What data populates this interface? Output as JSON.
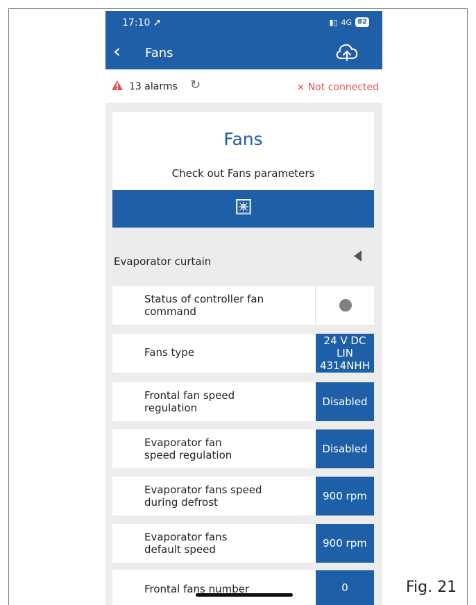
{
  "status_bar": {
    "time": "17:10 ➚",
    "network": "4G",
    "battery": "82"
  },
  "nav": {
    "title": "Fans"
  },
  "alarm_bar": {
    "count_text": "13 alarms",
    "connection_status": "× Not connected"
  },
  "card": {
    "title": "Fans",
    "subtitle": "Check out Fans parameters"
  },
  "section": {
    "label": "Evaporator curtain"
  },
  "params": [
    {
      "label": "Status of controller fan command",
      "value": ""
    },
    {
      "label": "Fans type",
      "value": "24 V DC LIN 4314NHH"
    },
    {
      "label": "Frontal fan speed regulation",
      "value": "Disabled"
    },
    {
      "label": "Evaporator fan speed regulation",
      "value": "Disabled"
    },
    {
      "label": "Evaporator fans speed during defrost",
      "value": "900 rpm"
    },
    {
      "label": "Evaporator fans default speed",
      "value": "900 rpm"
    },
    {
      "label": "Frontal fans number",
      "value": "0"
    }
  ],
  "figure_label": "Fig. 21",
  "icons": {
    "back": "chevron-left-icon",
    "upload": "cloud-upload-icon",
    "alarm": "warning-icon",
    "refresh": "refresh-icon",
    "card": "fan-icon",
    "section": "triangle-left-icon"
  },
  "colors": {
    "primary": "#1f5fa8",
    "error": "#e64d4d",
    "status_dot": "#808080",
    "background": "#ececec"
  }
}
